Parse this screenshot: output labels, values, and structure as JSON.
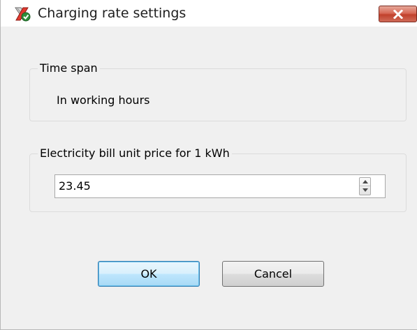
{
  "window": {
    "title": "Charging rate settings"
  },
  "icons": {
    "app": "app-icon",
    "close": "close-icon",
    "spin_up": "arrow-up-icon",
    "spin_down": "arrow-down-icon"
  },
  "time_span_group": {
    "label": "Time span",
    "value": "In working hours"
  },
  "price_group": {
    "label": "Electricity bill unit price for 1 kWh",
    "value": "23.45"
  },
  "buttons": {
    "ok": "OK",
    "cancel": "Cancel"
  },
  "colors": {
    "close_button": "#c7503b",
    "dialog_background": "#f0f0f0",
    "default_button_border": "#3c7fb1"
  }
}
